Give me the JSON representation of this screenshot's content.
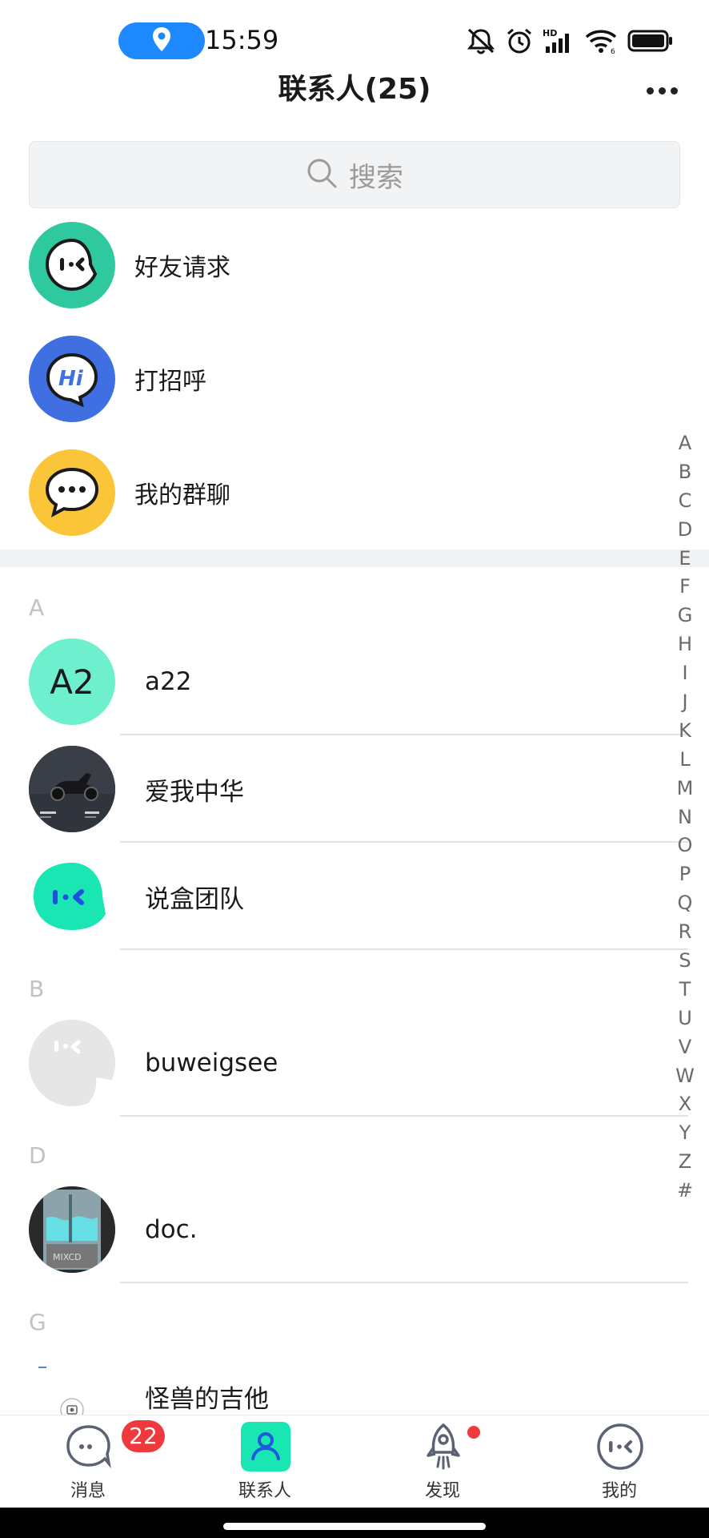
{
  "status_bar": {
    "time": "15:59",
    "icons": [
      "location-icon",
      "mute-icon",
      "alarm-icon",
      "hd-signal-icon",
      "wifi-icon",
      "battery-icon"
    ],
    "hd_label": "HD",
    "wifi_sub": "6",
    "location_pill_color": "#1e88ff"
  },
  "header": {
    "title": "联系人(25)",
    "more_icon": "more-dots-icon"
  },
  "search": {
    "placeholder": "搜索"
  },
  "features": [
    {
      "label": "好友请求",
      "icon": "friend-request-icon",
      "color": "#2fc9a0"
    },
    {
      "label": "打招呼",
      "icon": "hi-greeting-icon",
      "color": "#3f6fe0",
      "icon_text": "Hi"
    },
    {
      "label": "我的群聊",
      "icon": "group-chat-icon",
      "color": "#fbc53a"
    }
  ],
  "sections": [
    {
      "letter": "A",
      "contacts": [
        {
          "name": "a22",
          "avatar_text": "A2",
          "avatar_color": "#6ef0cf"
        },
        {
          "name": "爱我中华",
          "avatar_text": "",
          "avatar_color": "#2b2f36"
        },
        {
          "name": "说盒团队",
          "avatar_text": "",
          "avatar_color": "#19e6b3"
        }
      ]
    },
    {
      "letter": "B",
      "contacts": [
        {
          "name": "buweigsee",
          "avatar_text": "",
          "avatar_color": "#e6e6e6"
        }
      ]
    },
    {
      "letter": "D",
      "contacts": [
        {
          "name": "doc.",
          "avatar_text": "",
          "avatar_color": "#5c7f86"
        }
      ]
    },
    {
      "letter": "G",
      "contacts": [
        {
          "name": "怪兽的吉他",
          "avatar_text": "",
          "avatar_color": "#ffffff"
        }
      ]
    }
  ],
  "alphabet_index": [
    "A",
    "B",
    "C",
    "D",
    "E",
    "F",
    "G",
    "H",
    "I",
    "J",
    "K",
    "L",
    "M",
    "N",
    "O",
    "P",
    "Q",
    "R",
    "S",
    "T",
    "U",
    "V",
    "W",
    "X",
    "Y",
    "Z",
    "#"
  ],
  "tabs": [
    {
      "label": "消息",
      "icon": "message-icon",
      "badge": "22"
    },
    {
      "label": "联系人",
      "icon": "contacts-icon",
      "active": true,
      "active_color": "#19e6b3"
    },
    {
      "label": "发现",
      "icon": "discover-rocket-icon",
      "dot": true
    },
    {
      "label": "我的",
      "icon": "profile-icon"
    }
  ]
}
